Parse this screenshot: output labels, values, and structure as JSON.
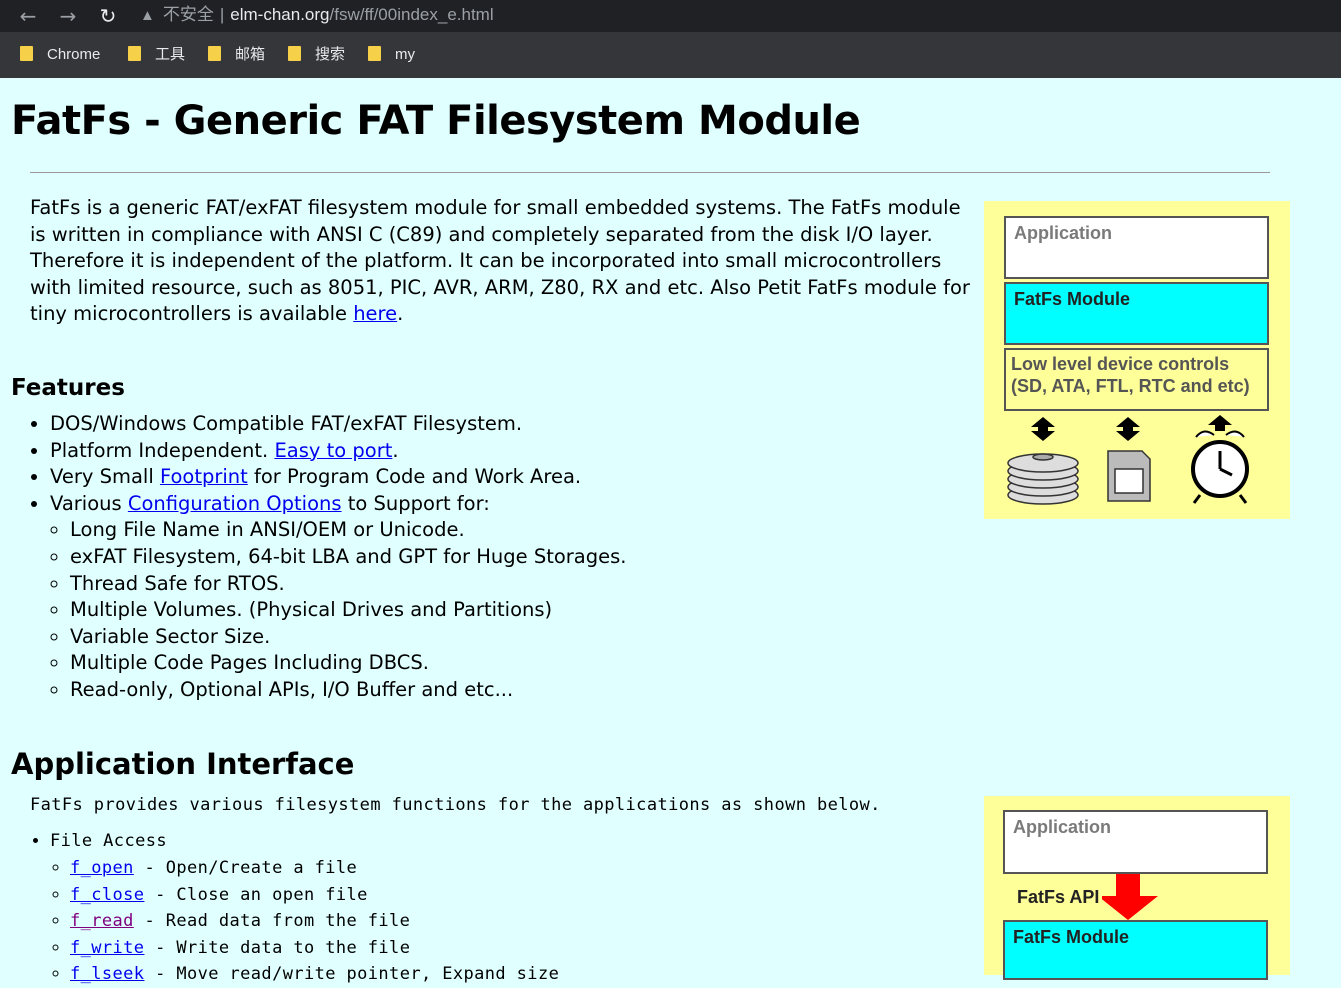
{
  "browser": {
    "security_warning": "不安全",
    "url_host": "elm-chan.org",
    "url_path": "/fsw/ff/00index_e.html",
    "bookmarks": [
      "Chrome",
      "工具",
      "邮箱",
      "搜索",
      "my"
    ]
  },
  "page": {
    "title": "FatFs - Generic FAT Filesystem Module",
    "intro_before_link": "FatFs is a generic FAT/exFAT filesystem module for small embedded systems. The FatFs module is written in compliance with ANSI C (C89) and completely separated from the disk I/O layer. Therefore it is independent of the platform. It can be incorporated into small microcontrollers with limited resource, such as 8051, PIC, AVR, ARM, Z80, RX and etc. Also Petit FatFs module for tiny microcontrollers is available ",
    "intro_link": "here",
    "intro_after_link": ".",
    "features_heading": "Features",
    "features": {
      "f1": "DOS/Windows Compatible FAT/exFAT Filesystem.",
      "f2_text": "Platform Independent. ",
      "f2_link": "Easy to port",
      "f2_after": ".",
      "f3_before": "Very Small ",
      "f3_link": "Footprint",
      "f3_after": " for Program Code and Work Area.",
      "f4_before": "Various ",
      "f4_link": "Configuration Options",
      "f4_after": " to Support for:",
      "sub": [
        "Long File Name in ANSI/OEM or Unicode.",
        "exFAT Filesystem, 64-bit LBA and GPT for Huge Storages.",
        "Thread Safe for RTOS.",
        "Multiple Volumes. (Physical Drives and Partitions)",
        "Variable Sector Size.",
        "Multiple Code Pages Including DBCS.",
        "Read-only, Optional APIs, I/O Buffer and etc..."
      ]
    },
    "api_heading": "Application Interface",
    "api_desc": "FatFs provides various filesystem functions for the applications as shown below.",
    "api_group": "File Access",
    "api_items": [
      {
        "name": "f_open",
        "desc": " - Open/Create a file"
      },
      {
        "name": "f_close",
        "desc": " - Close an open file"
      },
      {
        "name": "f_read",
        "desc": " - Read data from the file"
      },
      {
        "name": "f_write",
        "desc": " - Write data to the file"
      },
      {
        "name": "f_lseek",
        "desc": " - Move read/write pointer, Expand size"
      }
    ]
  },
  "diagram1": {
    "application": "Application",
    "module": "FatFs Module",
    "lowlevel_line1": "Low level device controls",
    "lowlevel_line2": "(SD, ATA, FTL, RTC and etc)"
  },
  "diagram2": {
    "application": "Application",
    "api_label": "FatFs API",
    "module": "FatFs Module"
  },
  "colors": {
    "page_bg": "#e0ffff",
    "diagram_bg": "#ffff99",
    "module_box": "#00ffff",
    "api_arrow": "#ff0000",
    "link": "#0000ee",
    "visited_link": "#800080"
  }
}
